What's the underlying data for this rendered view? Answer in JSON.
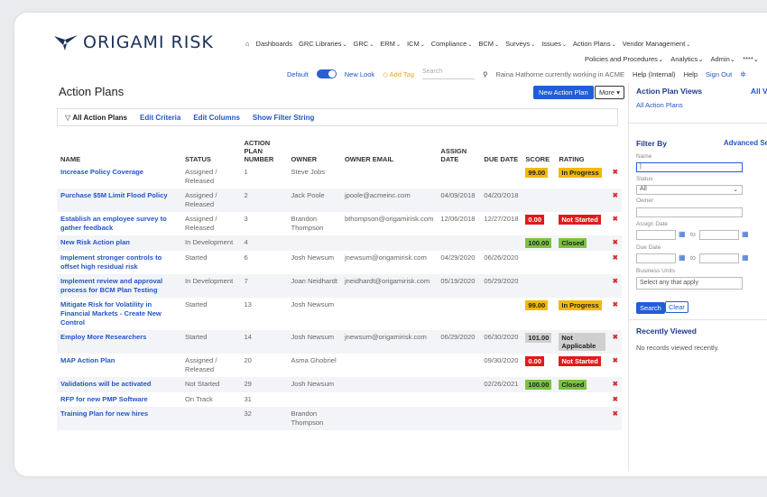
{
  "brand": {
    "name": "ORIGAMI RISK"
  },
  "topnav": [
    "Dashboards",
    "GRC Libraries",
    "GRC",
    "ERM",
    "ICM",
    "Compliance",
    "BCM",
    "Surveys",
    "Issues",
    "Action Plans",
    "Vendor Management"
  ],
  "topnav2": [
    "Policies and Procedures",
    "Analytics",
    "Admin",
    "****"
  ],
  "toolbar": {
    "default_label": "Default",
    "newlook_label": "New Look",
    "addtag_label": "Add Tag",
    "search_placeholder": "Search",
    "working_in": "Raina Hathorne currently working in ACME",
    "help_internal": "Help (Internal)",
    "help": "Help",
    "signout": "Sign Out"
  },
  "page": {
    "title": "Action Plans",
    "new_button": "New Action Plan",
    "more_button": "More"
  },
  "filterbar": {
    "current": "All Action Plans",
    "edit_criteria": "Edit Criteria",
    "edit_columns": "Edit Columns",
    "show_filter": "Show Filter String"
  },
  "table": {
    "headers": [
      "NAME",
      "STATUS",
      "ACTION PLAN NUMBER",
      "OWNER",
      "OWNER EMAIL",
      "ASSIGN DATE",
      "DUE DATE",
      "SCORE",
      "RATING"
    ],
    "rows": [
      {
        "name": "Increase Policy Coverage",
        "status": "Assigned / Released",
        "number": "1",
        "owner": "Steve Jobs",
        "email": "",
        "assign": "",
        "due": "",
        "score": "99.00",
        "score_color": "#f2b90c",
        "rating": "In Progress",
        "rating_color": "#f2b90c"
      },
      {
        "name": "Purchase $5M Limit Flood Policy",
        "status": "Assigned / Released",
        "number": "2",
        "owner": "Jack Poole",
        "email": "jpoole@acmeinc.com",
        "assign": "04/09/2018",
        "due": "04/20/2018",
        "score": "",
        "score_color": "",
        "rating": "",
        "rating_color": ""
      },
      {
        "name": "Establish an employee survey to gather feedback",
        "status": "Assigned / Released",
        "number": "3",
        "owner": "Brandon Thompson",
        "email": "bthompson@origamirisk.com",
        "assign": "12/06/2018",
        "due": "12/27/2018",
        "score": "0.00",
        "score_color": "#e21a1a",
        "rating": "Not Started",
        "rating_color": "#e21a1a"
      },
      {
        "name": "New Risk Action plan",
        "status": "In Development",
        "number": "4",
        "owner": "",
        "email": "",
        "assign": "",
        "due": "",
        "score": "100.00",
        "score_color": "#7cc242",
        "rating": "Closed",
        "rating_color": "#7cc242"
      },
      {
        "name": "Implement stronger controls to offset high residual risk",
        "status": "Started",
        "number": "6",
        "owner": "Josh Newsum",
        "email": "jnewsum@origamirisk.com",
        "assign": "04/29/2020",
        "due": "06/26/2020",
        "score": "",
        "score_color": "",
        "rating": "",
        "rating_color": ""
      },
      {
        "name": "Implement review and approval process for BCM Plan Testing",
        "status": "In Development",
        "number": "7",
        "owner": "Joan Neidhardt",
        "email": "jneidhardt@origamirisk.com",
        "assign": "05/19/2020",
        "due": "05/29/2020",
        "score": "",
        "score_color": "",
        "rating": "",
        "rating_color": ""
      },
      {
        "name": "Mitigate Risk for Volatility in Financial Markets - Create New Control",
        "status": "Started",
        "number": "13",
        "owner": "Josh Newsum",
        "email": "",
        "assign": "",
        "due": "",
        "score": "99.00",
        "score_color": "#f2b90c",
        "rating": "In Progress",
        "rating_color": "#f2b90c"
      },
      {
        "name": "Employ More Researchers",
        "status": "Started",
        "number": "14",
        "owner": "Josh Newsum",
        "email": "jnewsum@origamirisk.com",
        "assign": "06/29/2020",
        "due": "06/30/2020",
        "score": "101.00",
        "score_color": "#cfcfcf",
        "rating": "Not Applicable",
        "rating_color": "#cfcfcf"
      },
      {
        "name": "MAP Action Plan",
        "status": "Assigned / Released",
        "number": "20",
        "owner": "Asma Ghobriel",
        "email": "",
        "assign": "",
        "due": "09/30/2020",
        "score": "0.00",
        "score_color": "#e21a1a",
        "rating": "Not Started",
        "rating_color": "#e21a1a"
      },
      {
        "name": "Validations will be activated",
        "status": "Not Started",
        "number": "29",
        "owner": "Josh Newsum",
        "email": "",
        "assign": "",
        "due": "02/26/2021",
        "score": "100.00",
        "score_color": "#7cc242",
        "rating": "Closed",
        "rating_color": "#7cc242"
      },
      {
        "name": "RFP for new PMP Software",
        "status": "On Track",
        "number": "31",
        "owner": "",
        "email": "",
        "assign": "",
        "due": "",
        "score": "",
        "score_color": "",
        "rating": "",
        "rating_color": ""
      },
      {
        "name": "Training Plan for new hires",
        "status": "",
        "number": "32",
        "owner": "Brandon Thompson",
        "email": "",
        "assign": "",
        "due": "",
        "score": "",
        "score_color": "",
        "rating": "",
        "rating_color": ""
      }
    ]
  },
  "sidebar": {
    "views_title": "Action Plan Views",
    "all_views": "All Views",
    "current_view": "All Action Plans",
    "filter_by": "Filter By",
    "advanced_search": "Advanced Search",
    "name_label": "Name",
    "status_label": "Status",
    "status_value": "All",
    "owner_label": "Owner",
    "assign_date_label": "Assign Date",
    "due_date_label": "Due Date",
    "to": "to",
    "bu_label": "Business Units",
    "bu_placeholder": "Select any that apply",
    "search_btn": "Search",
    "clear_btn": "Clear",
    "recent_title": "Recently Viewed",
    "recent_empty": "No records viewed recently."
  },
  "colors": {
    "accent": "#1f5fd6",
    "brand": "#1d3058",
    "link": "#2355c6"
  }
}
